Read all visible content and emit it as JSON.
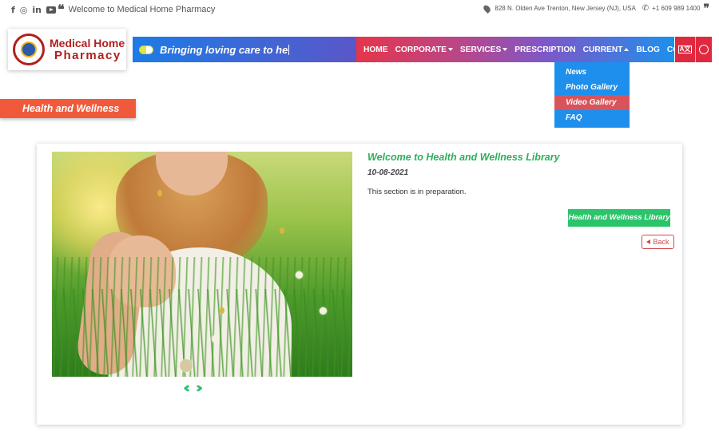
{
  "topbar": {
    "social": [
      {
        "name": "facebook-icon",
        "glyph": "f"
      },
      {
        "name": "instagram-icon",
        "glyph": "◎"
      },
      {
        "name": "linkedin-icon",
        "glyph": "in"
      },
      {
        "name": "youtube-icon"
      }
    ],
    "welcome": "Welcome to Medical Home Pharmacy",
    "address": "828 N. Olden Ave Trenton, New Jersey (NJ), USA",
    "phone": "+1 609 989 1400"
  },
  "logo": {
    "line1": "Medical Home",
    "line2": "Pharmacy"
  },
  "ticker": {
    "text": "Bringing loving care to he"
  },
  "nav": {
    "items": [
      {
        "label": "HOME"
      },
      {
        "label": "CORPORATE"
      },
      {
        "label": "SERVICES"
      },
      {
        "label": "PRESCRIPTION"
      },
      {
        "label": "CURRENT"
      },
      {
        "label": "BLOG"
      },
      {
        "label": "CONTACT"
      }
    ],
    "lang_label": "A文"
  },
  "dropdown": {
    "items": [
      {
        "label": "News"
      },
      {
        "label": "Photo Gallery"
      },
      {
        "label": "Video Gallery",
        "active": true
      },
      {
        "label": "FAQ"
      }
    ]
  },
  "section_tag": "Health and Wellness",
  "article": {
    "title": "Welcome to Health and Wellness Library",
    "date": "10-08-2021",
    "body": "This section is in preparation.",
    "library_button": "Health and Wellness Library",
    "back_button": "Back"
  },
  "colors": {
    "nav_start": "#e6354a",
    "nav_end": "#1e8fec",
    "accent_green": "#2cc46a",
    "section_orange": "#f05a3a",
    "brand_red": "#b0201f"
  }
}
